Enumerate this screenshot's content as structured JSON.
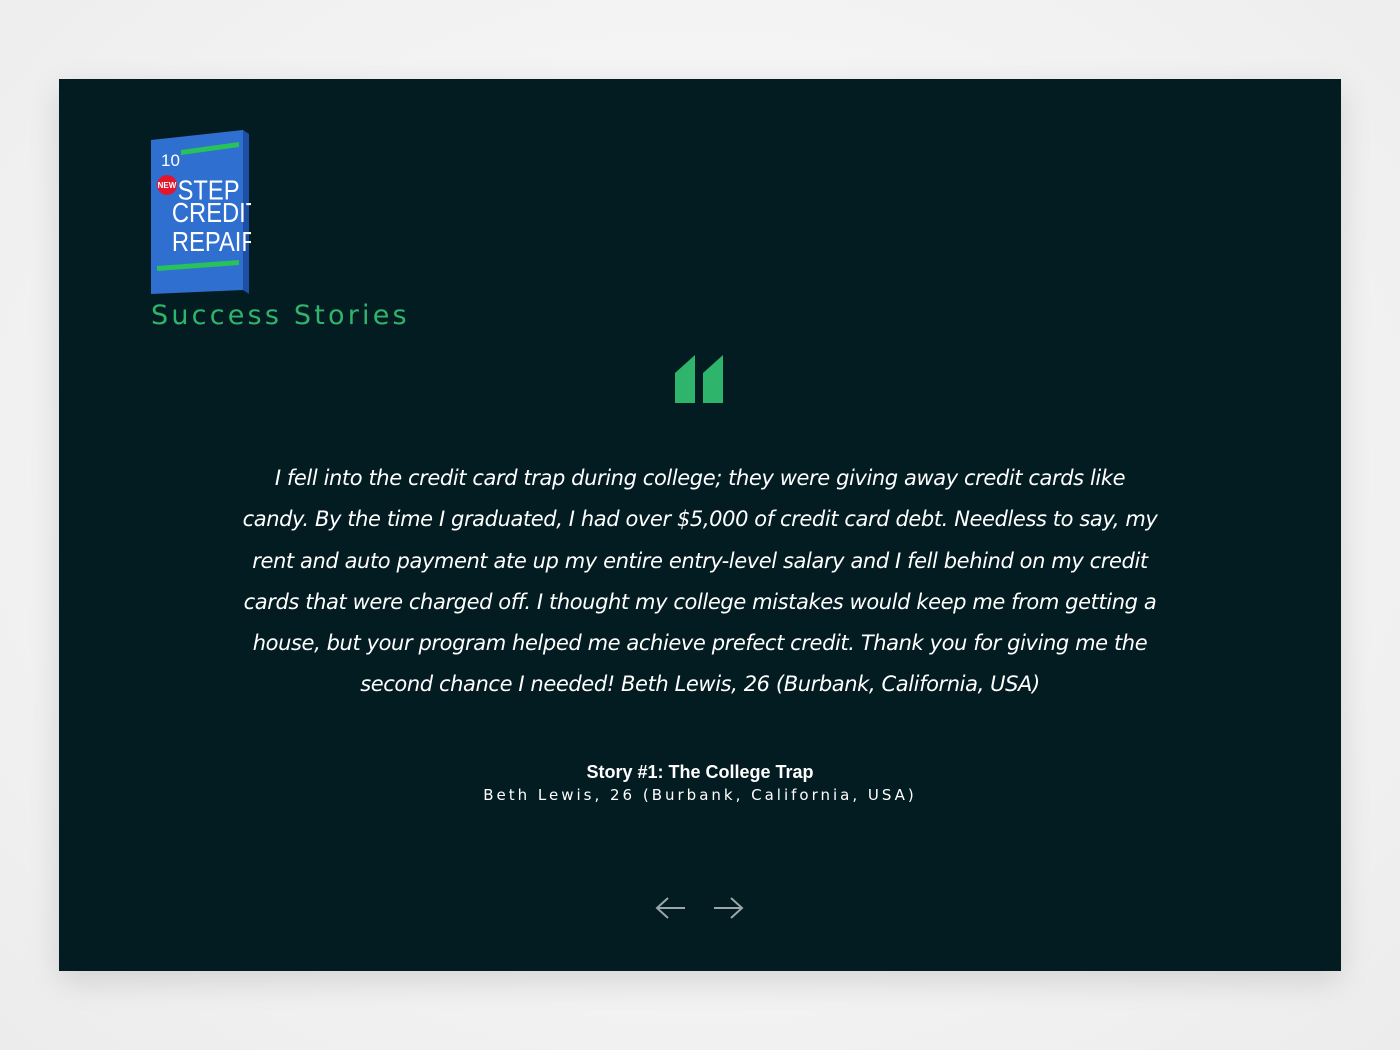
{
  "book": {
    "number": "10",
    "badge": "NEW",
    "line1": "STEP",
    "line2": "CREDIT",
    "line3": "REPAIR",
    "colors": {
      "cover": "#2f6fd0",
      "spine": "#1d4fa6",
      "stripe": "#27c25a",
      "badge": "#e3162e"
    }
  },
  "section": {
    "title": "Success Stories"
  },
  "testimonial": {
    "quote": "I fell into the credit card trap during college; they were giving away credit cards like candy. By the time I graduated, I had over $5,000 of credit card debt. Needless to say, my rent and auto payment ate up my entire entry-level salary and I fell behind on my credit cards that were charged off. I thought my college mistakes would keep me from getting a house, but your program helped me achieve prefect credit. Thank you for giving me the second chance I needed! Beth Lewis, 26 (Burbank, California, USA)",
    "title": "Story #1: The College Trap",
    "author": "Beth Lewis, 26 (Burbank, California, USA)"
  },
  "navigation": {
    "prev_icon": "arrow-left-icon",
    "next_icon": "arrow-right-icon"
  },
  "colors": {
    "background": "#031c21",
    "accent": "#2fb56b",
    "text": "#ffffff",
    "arrow": "#9aa6a8"
  }
}
